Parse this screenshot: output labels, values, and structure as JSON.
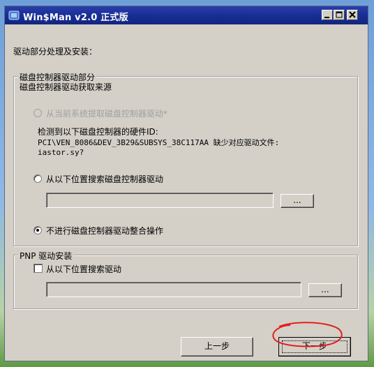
{
  "window": {
    "title": "Win$Man v2.0 正式版",
    "icon": "app-icon",
    "controls": [
      "minimize-icon",
      "maximize-icon",
      "close-icon"
    ]
  },
  "page": {
    "heading": "驱动部分处理及安装："
  },
  "disk_group": {
    "legend": "磁盘控制器驱动部分",
    "source_label": "磁盘控制器驱动获取来源",
    "option_current": "从当前系统提取磁盘控制器驱动*",
    "detect_line1": "检测到以下磁盘控制器的硬件ID:",
    "detect_line2": "PCI\\VEN_8086&DEV_3B29&SUBSYS_38C117AA 缺少对应驱动文件:",
    "detect_line3": "iastor.sy?",
    "option_search": "从以下位置搜索磁盘控制器驱动",
    "path_value": "",
    "browse_label": "...",
    "option_skip": "不进行磁盘控制器驱动整合操作"
  },
  "pnp_group": {
    "legend": "PNP 驱动安装",
    "checkbox_label": "从以下位置搜索驱动",
    "path_value": "",
    "browse_label": "..."
  },
  "footer": {
    "prev_label": "上一步",
    "next_label": "下一步"
  },
  "colors": {
    "titlebar": "#1a2f98",
    "face": "#d4d0c8",
    "annotation": "#e02020"
  }
}
